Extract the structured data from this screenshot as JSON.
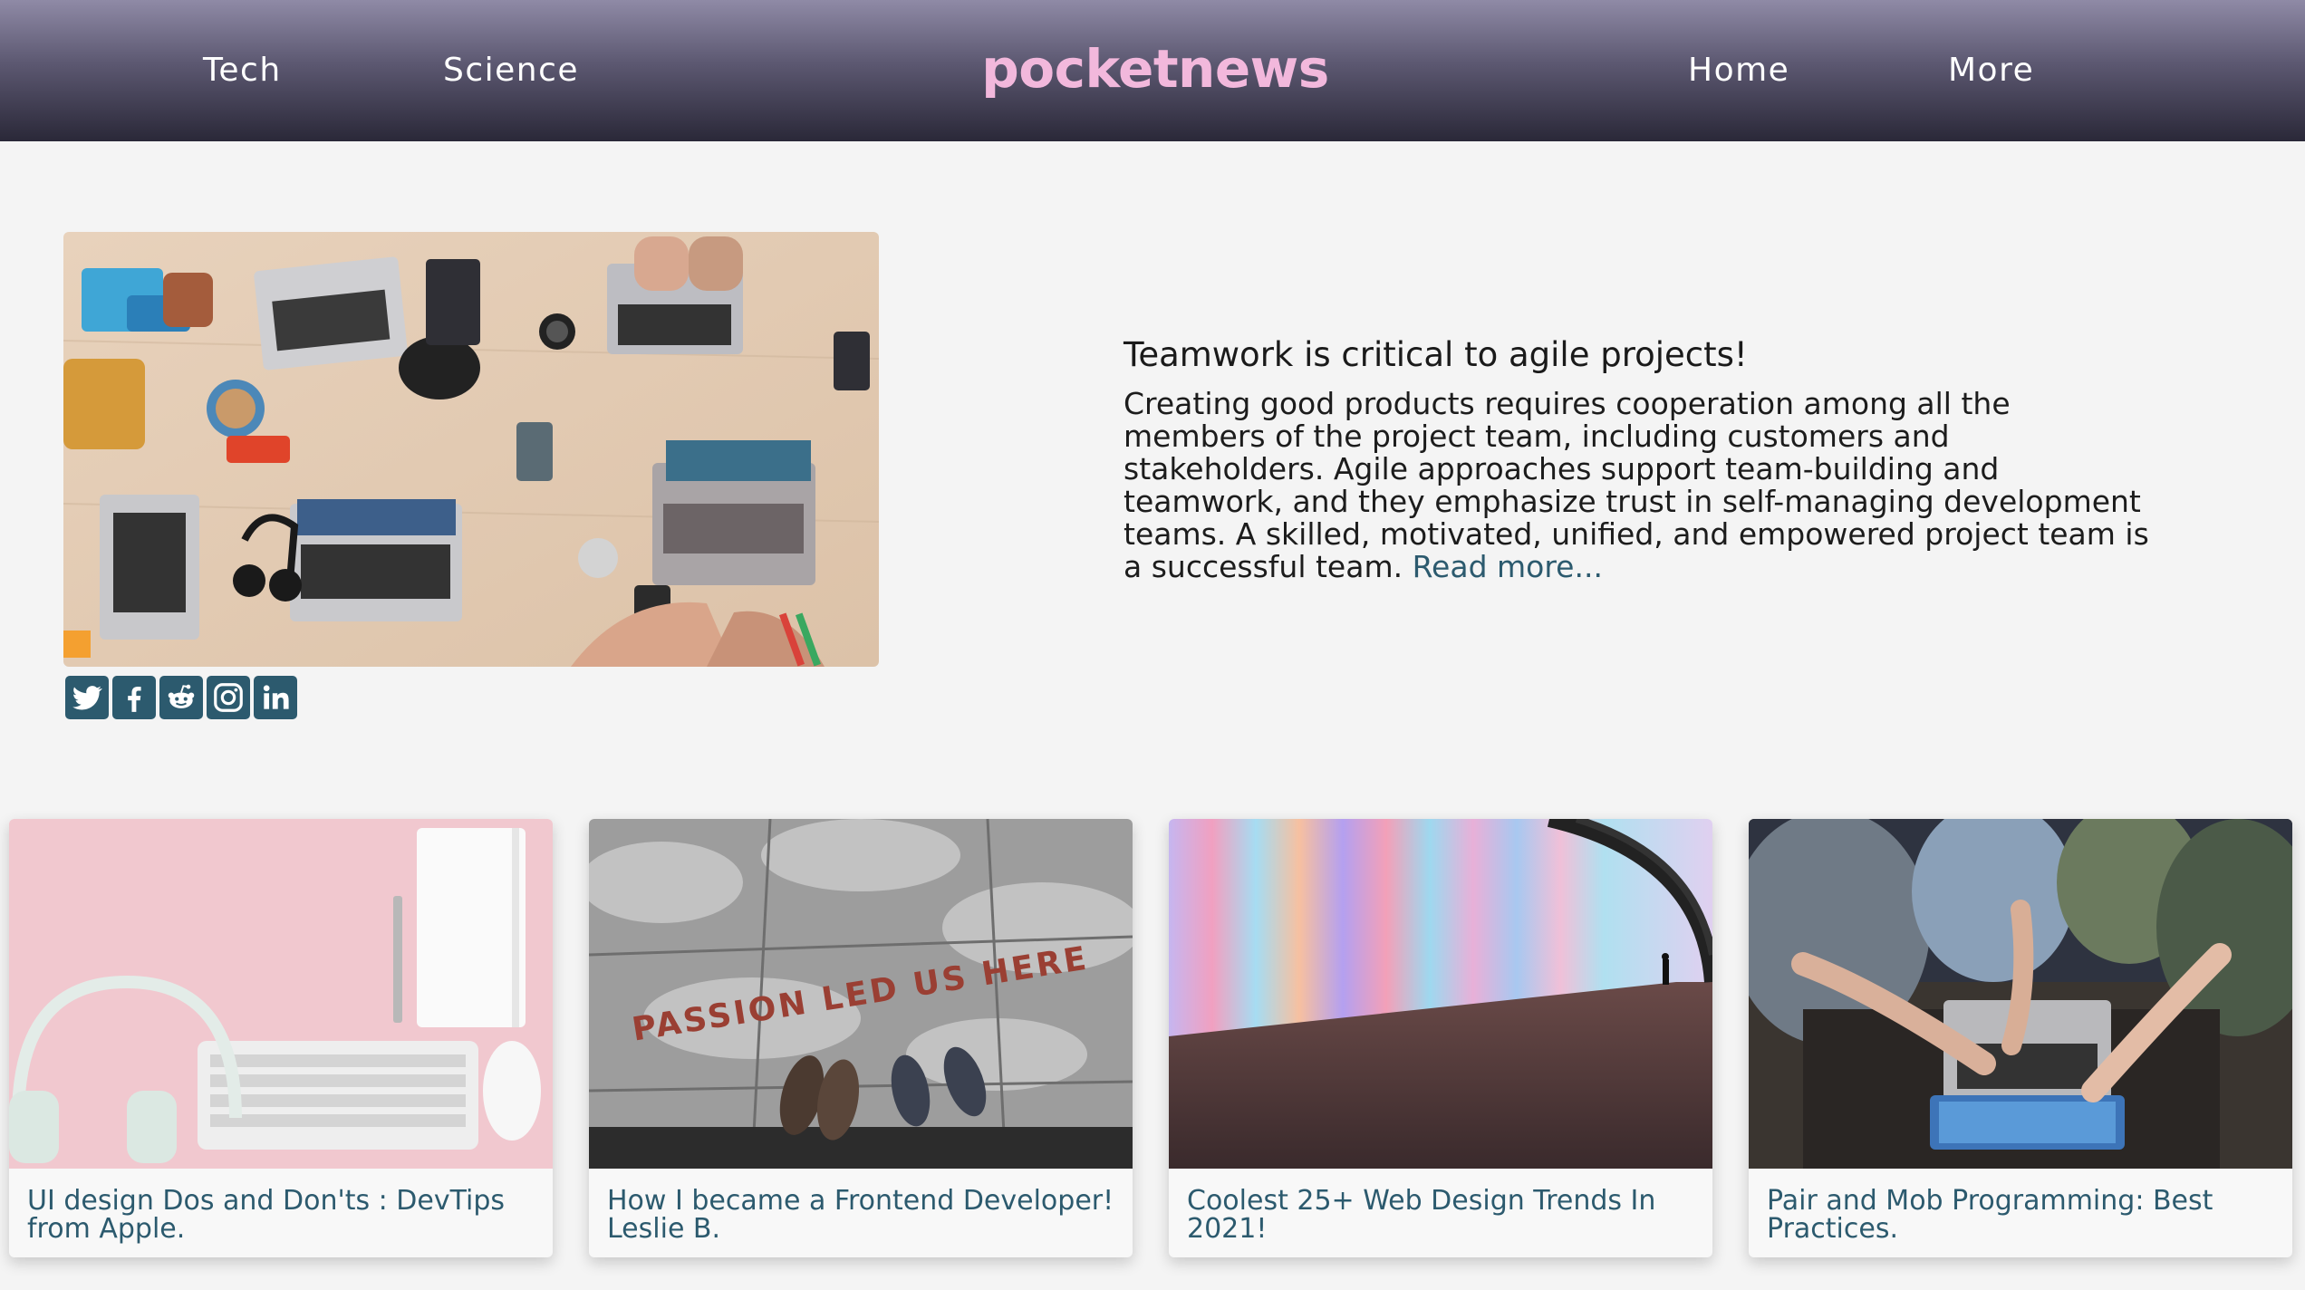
{
  "header": {
    "brand": "pocketnews",
    "nav_left": [
      "Tech",
      "Science"
    ],
    "nav_right": [
      "Home",
      "More"
    ]
  },
  "featured": {
    "title": "Teamwork is critical to agile projects!",
    "body": "Creating good products requires cooperation among all the members of the project team, including customers and stakeholders. Agile approaches support team-building and teamwork, and they emphasize trust in self-managing development teams. A skilled, motivated, unified, and empowered project team is a successful team.",
    "read_more": "Read more..."
  },
  "share_icons": [
    "twitter-icon",
    "facebook-icon",
    "reddit-icon",
    "instagram-icon",
    "linkedin-icon"
  ],
  "articles": [
    {
      "title": "UI design Dos and Don'ts : DevTips from Apple."
    },
    {
      "title": "How I became a Frontend Developer! Leslie B."
    },
    {
      "title": "Coolest 25+ Web Design Trends In 2021!"
    },
    {
      "title": "Pair and Mob Programming: Best Practices."
    }
  ],
  "photo_text": {
    "street_sign": "PASSION LED US HERE"
  },
  "colors": {
    "accent": "#2c5a6e",
    "brand": "#f2b8dc",
    "header_top": "#8f8aa6",
    "header_bottom": "#2a2838",
    "page_bg": "#f4f4f4"
  }
}
